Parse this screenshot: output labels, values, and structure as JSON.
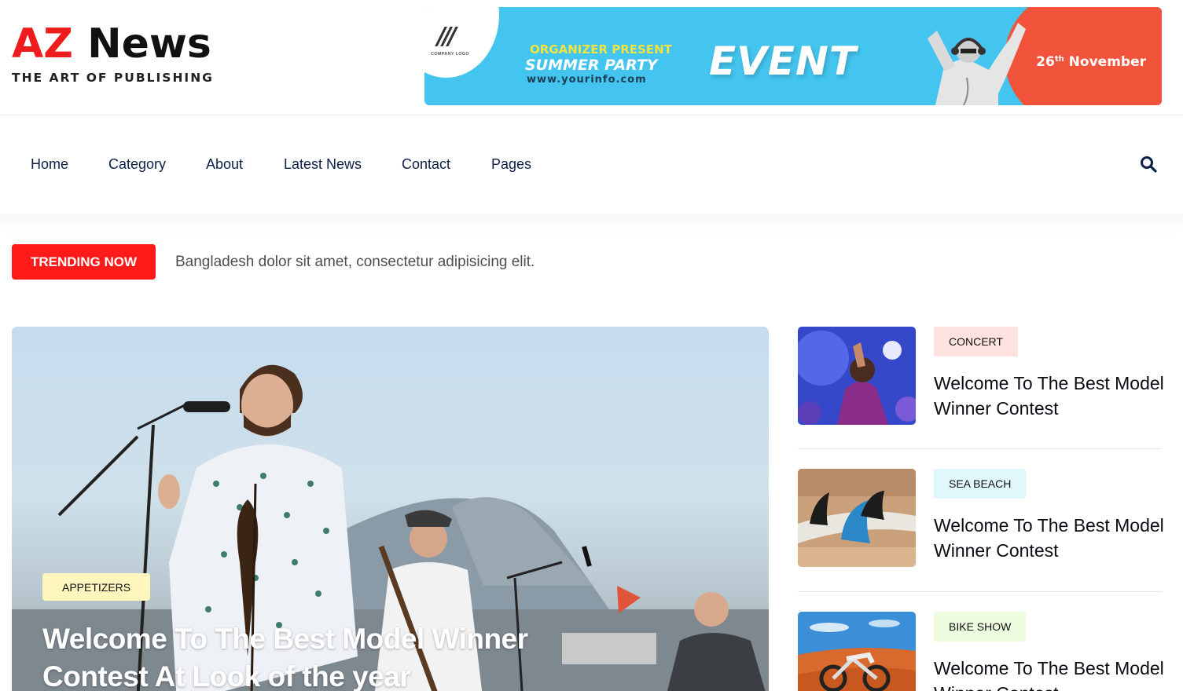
{
  "logo": {
    "part1": "AZ",
    "part2": "News",
    "tagline": "THE ART OF PUBLISHING"
  },
  "banner": {
    "company_logo": "COMPANY LOGO",
    "organizer": "ORGANIZER PRESENT",
    "party": "SUMMER PARTY",
    "url": "www.yourinfo.com",
    "event": "EVENT",
    "date_day": "26",
    "date_suffix": "th",
    "date_month": "November"
  },
  "nav": {
    "items": [
      "Home",
      "Category",
      "About",
      "Latest News",
      "Contact",
      "Pages"
    ],
    "search_icon": "search-icon"
  },
  "trending": {
    "label": "TRENDING NOW",
    "text": "Bangladesh dolor sit amet, consectetur adipisicing elit."
  },
  "hero": {
    "category": "APPETIZERS",
    "title": "Welcome To The Best Model Winner Contest At Look of the year"
  },
  "side_posts": [
    {
      "category": "CONCERT",
      "category_color": "#fde3e0",
      "title": "Welcome To The Best Model Winner Contest"
    },
    {
      "category": "SEA BEACH",
      "category_color": "#e0f7fb",
      "title": "Welcome To The Best Model Winner Contest"
    },
    {
      "category": "BIKE SHOW",
      "category_color": "#eefce0",
      "title": "Welcome To The Best Model Winner Contest"
    }
  ],
  "colors": {
    "brand_red": "#ee1c1c",
    "nav_text": "#0c2047",
    "trending_red": "#ff1a1a"
  }
}
